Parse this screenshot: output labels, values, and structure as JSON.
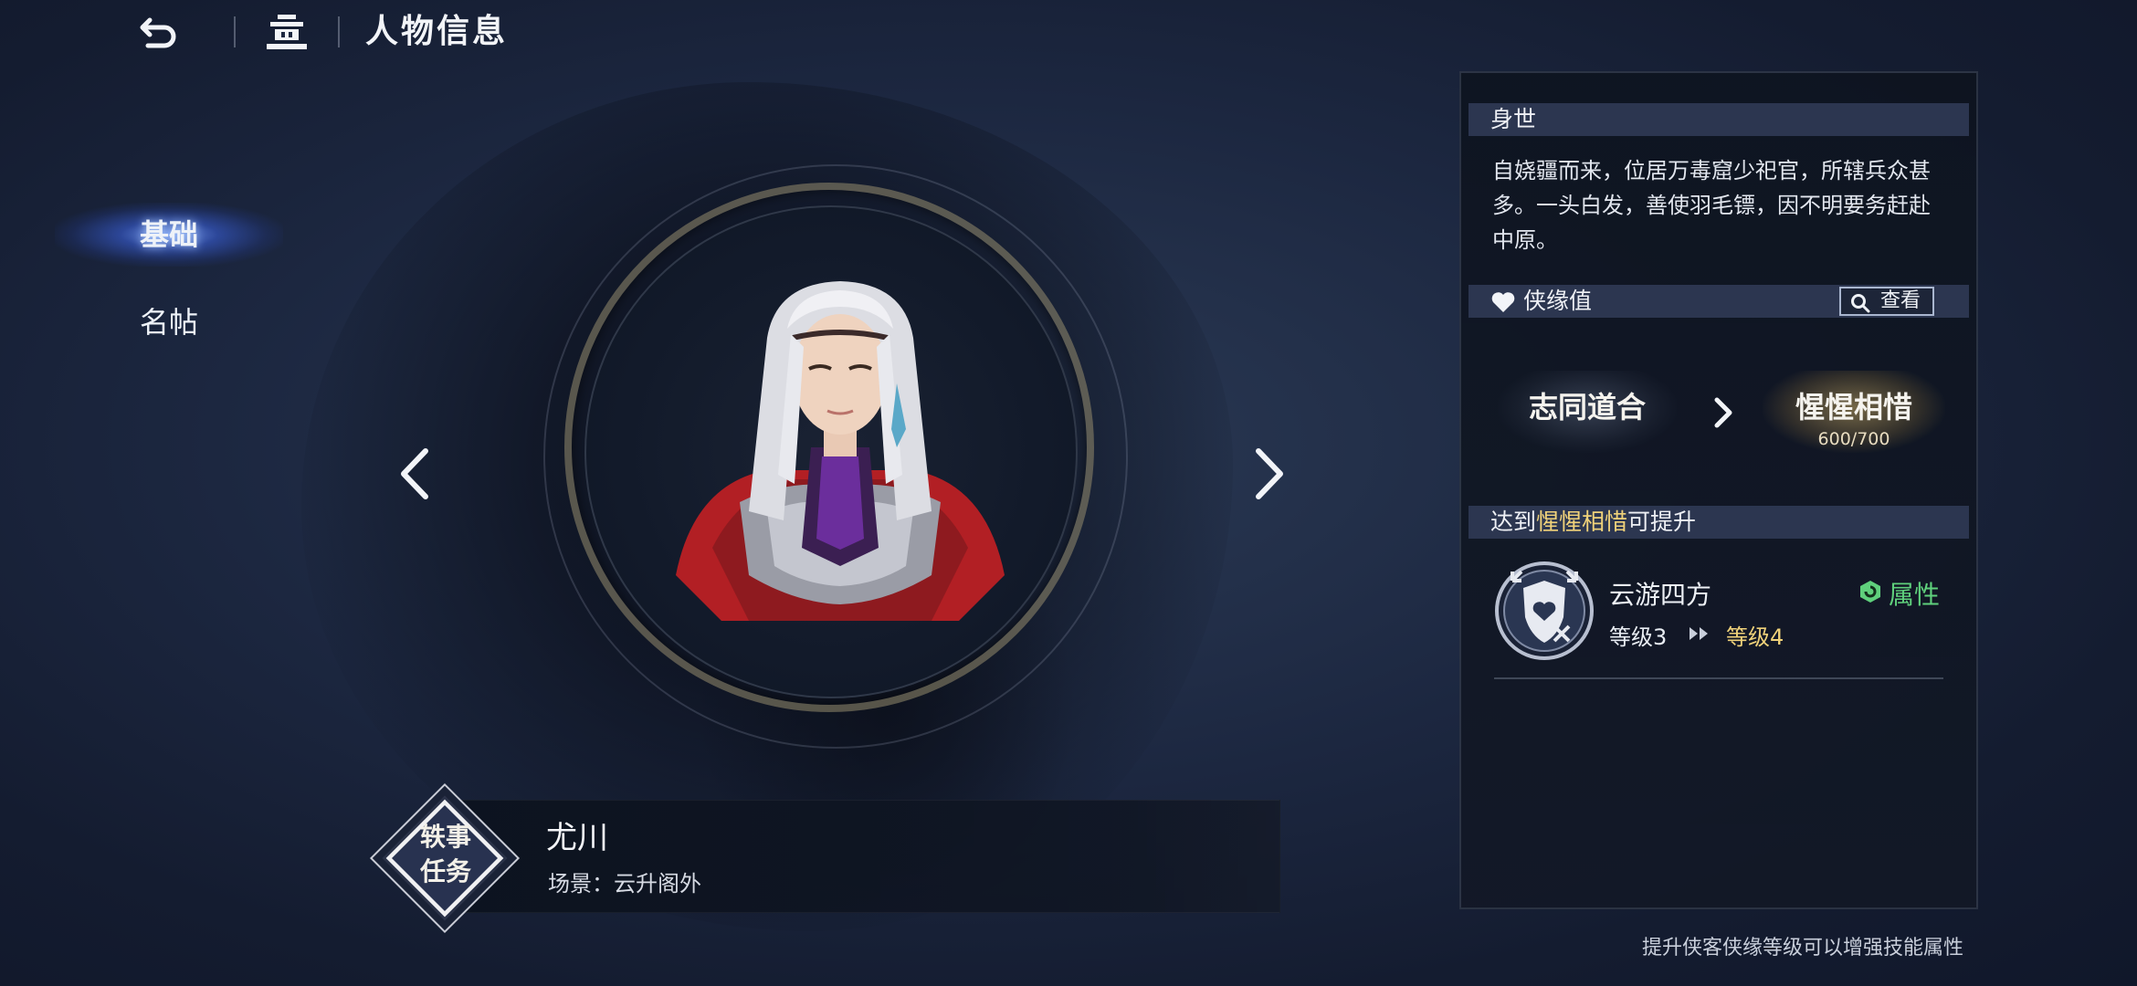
{
  "header": {
    "title": "人物信息",
    "back_icon": "back-arrow-icon",
    "home_icon": "home-icon"
  },
  "nav": {
    "items": [
      {
        "label": "基础",
        "active": true
      },
      {
        "label": "名帖",
        "active": false
      }
    ]
  },
  "character": {
    "name": "尤川",
    "scene": "场景：云升阁外",
    "quest_badge": {
      "line1": "轶事",
      "line2": "任务"
    }
  },
  "panel": {
    "origin_header": "身世",
    "origin_text": "自娆疆而来，位居万毒窟少祀官，所辖兵众甚多。一头白发，善使羽毛镖，因不明要务赶赴中原。",
    "affinity_header": "侠缘值",
    "view_label": "查看",
    "current_stage": "志同道合",
    "next_stage": "惺惺相惜",
    "progress_text": "600/700",
    "progress": {
      "current": 600,
      "max": 700
    },
    "unlock_prefix": "达到",
    "unlock_highlight": "惺惺相惜",
    "unlock_suffix": "可提升",
    "skill": {
      "name": "云游四方",
      "attr_label": "属性",
      "level_from": "等级3",
      "level_to": "等级4"
    }
  },
  "footer_tip": "提升侠客侠缘等级可以增强技能属性",
  "colors": {
    "accent_green": "#5fd07c",
    "accent_gold": "#f0d27a",
    "section_header": "#2c3650"
  }
}
